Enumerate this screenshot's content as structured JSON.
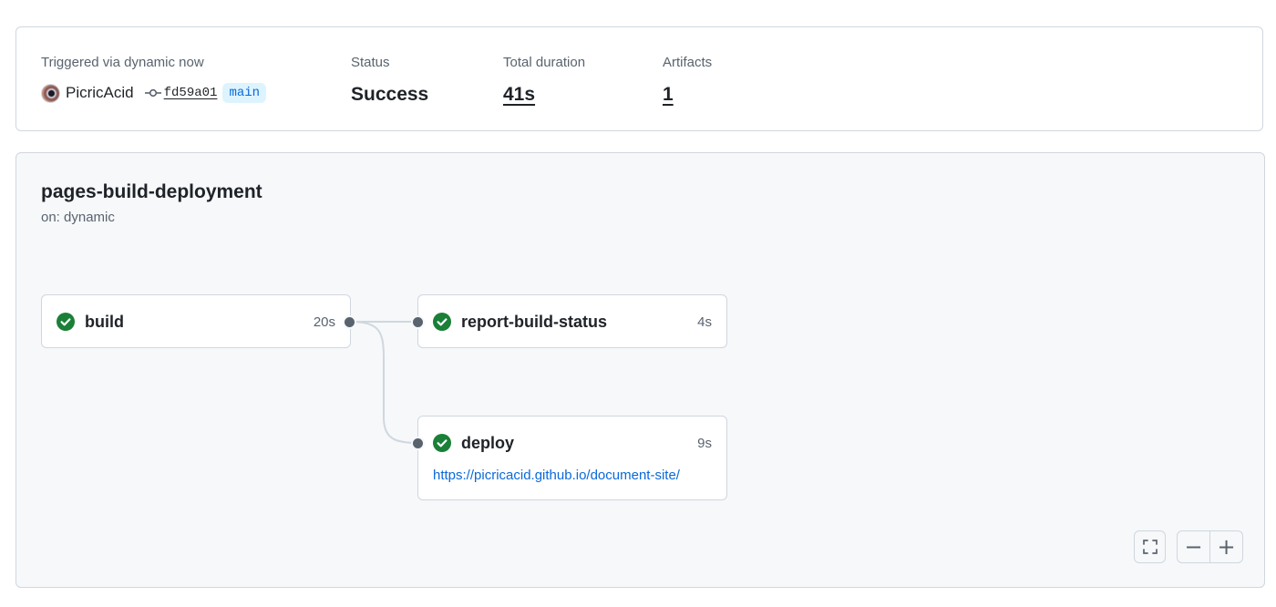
{
  "summary": {
    "trigger_label": "Triggered via dynamic now",
    "actor": "PicricAcid",
    "commit_sha": "fd59a01",
    "branch": "main",
    "status_label": "Status",
    "status_value": "Success",
    "duration_label": "Total duration",
    "duration_value": "41s",
    "artifacts_label": "Artifacts",
    "artifacts_value": "1"
  },
  "workflow": {
    "name": "pages-build-deployment",
    "trigger": "on: dynamic",
    "jobs": [
      {
        "name": "build",
        "duration": "20s",
        "status": "success"
      },
      {
        "name": "report-build-status",
        "duration": "4s",
        "status": "success"
      },
      {
        "name": "deploy",
        "duration": "9s",
        "status": "success",
        "url": "https://picricacid.github.io/document-site/"
      }
    ]
  },
  "controls": {
    "fullscreen_icon": "fullscreen-icon",
    "zoom_out_label": "−",
    "zoom_in_label": "+"
  },
  "colors": {
    "success": "#1a7f37",
    "link": "#0969da",
    "branch_bg": "#ddf4ff",
    "panel_bg": "#f6f8fa",
    "border": "#d0d7de"
  }
}
